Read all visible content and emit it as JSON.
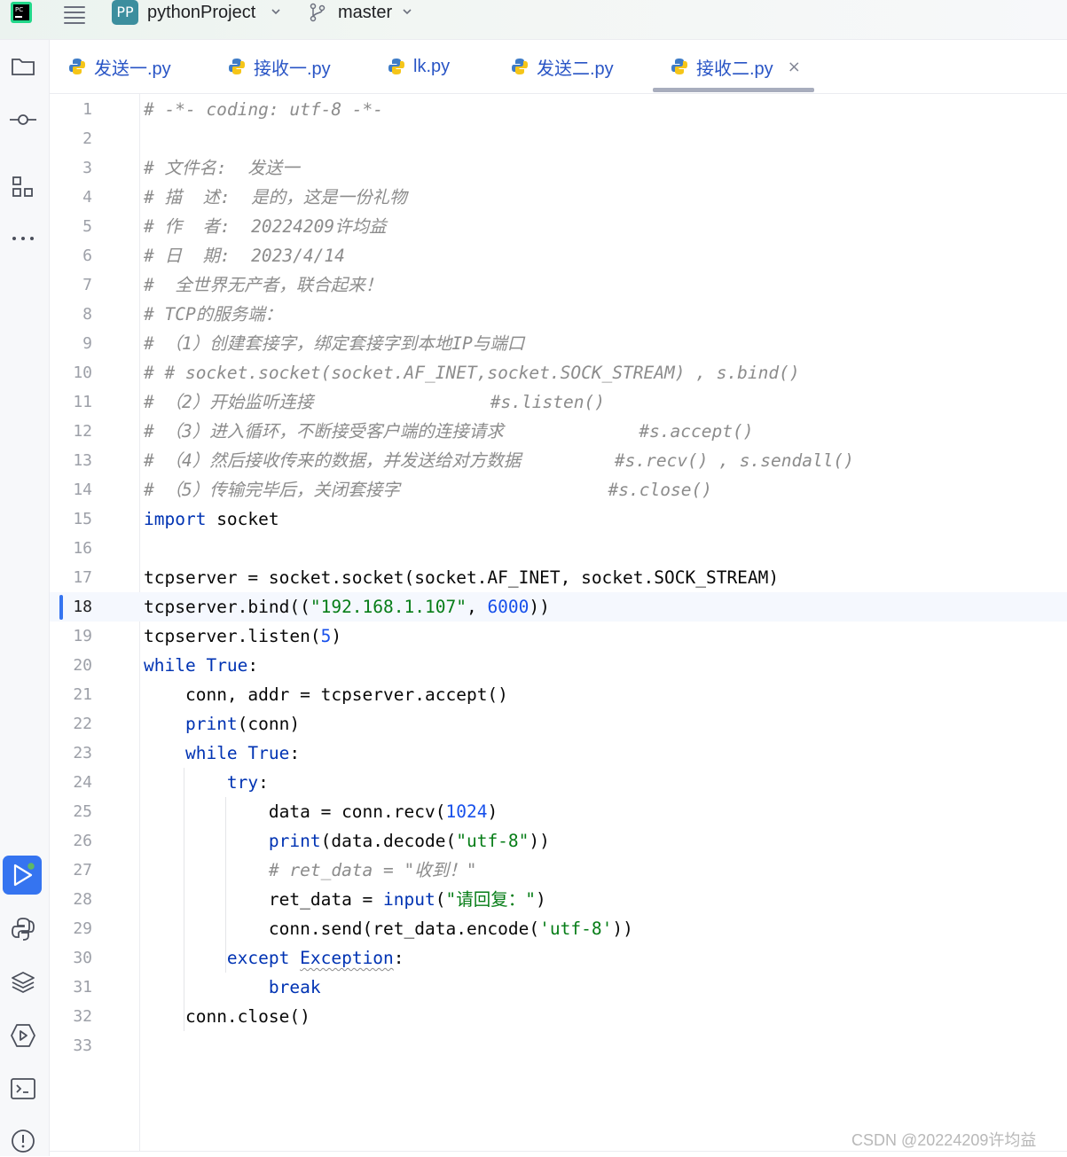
{
  "header": {
    "project_badge": "PP",
    "project_name": "pythonProject",
    "branch_name": "master"
  },
  "tabs": [
    {
      "label": "发送一.py"
    },
    {
      "label": "接收一.py"
    },
    {
      "label": "lk.py"
    },
    {
      "label": "发送二.py"
    },
    {
      "label": "接收二.py",
      "active": true,
      "close": "×"
    }
  ],
  "editor": {
    "current_line": 18,
    "line_numbers": [
      "1",
      "2",
      "3",
      "4",
      "5",
      "6",
      "7",
      "8",
      "9",
      "10",
      "11",
      "12",
      "13",
      "14",
      "15",
      "16",
      "17",
      "18",
      "19",
      "20",
      "21",
      "22",
      "23",
      "24",
      "25",
      "26",
      "27",
      "28",
      "29",
      "30",
      "31",
      "32",
      "33"
    ],
    "lines": [
      {
        "indent": "",
        "tokens": [
          {
            "t": "# -*- coding: utf-8 -*-",
            "c": "cmt"
          }
        ]
      },
      {
        "indent": "",
        "tokens": []
      },
      {
        "indent": "",
        "tokens": [
          {
            "t": "# 文件名:  发送一",
            "c": "cmt"
          }
        ]
      },
      {
        "indent": "",
        "tokens": [
          {
            "t": "# 描  述:  是的，这是一份礼物",
            "c": "cmt"
          }
        ]
      },
      {
        "indent": "",
        "tokens": [
          {
            "t": "# 作  者:  20224209许均益",
            "c": "cmt"
          }
        ]
      },
      {
        "indent": "",
        "tokens": [
          {
            "t": "# 日  期:  2023/4/14",
            "c": "cmt"
          }
        ]
      },
      {
        "indent": "",
        "tokens": [
          {
            "t": "#  全世界无产者，联合起来！",
            "c": "cmt"
          }
        ]
      },
      {
        "indent": "",
        "tokens": [
          {
            "t": "# TCP的服务端：",
            "c": "cmt"
          }
        ]
      },
      {
        "indent": "",
        "tokens": [
          {
            "t": "# （1）创建套接字，绑定套接字到本地IP与端口",
            "c": "cmt"
          }
        ]
      },
      {
        "indent": "",
        "tokens": [
          {
            "t": "# # socket.socket(socket.AF_INET,socket.SOCK_STREAM) , s.bind()",
            "c": "cmt"
          }
        ]
      },
      {
        "indent": "",
        "tokens": [
          {
            "t": "# （2）开始监听连接                 #s.listen()",
            "c": "cmt"
          }
        ]
      },
      {
        "indent": "",
        "tokens": [
          {
            "t": "# （3）进入循环，不断接受客户端的连接请求             #s.accept()",
            "c": "cmt"
          }
        ]
      },
      {
        "indent": "",
        "tokens": [
          {
            "t": "# （4）然后接收传来的数据，并发送给对方数据         #s.recv() , s.sendall()",
            "c": "cmt"
          }
        ]
      },
      {
        "indent": "",
        "tokens": [
          {
            "t": "# （5）传输完毕后，关闭套接字                    #s.close()",
            "c": "cmt"
          }
        ]
      },
      {
        "indent": "",
        "tokens": [
          {
            "t": "import",
            "c": "kw"
          },
          {
            "t": " socket",
            "c": ""
          }
        ]
      },
      {
        "indent": "",
        "tokens": []
      },
      {
        "indent": "",
        "tokens": [
          {
            "t": "tcpserver = socket.socket(socket.AF_INET, socket.SOCK_STREAM)",
            "c": ""
          }
        ]
      },
      {
        "indent": "",
        "tokens": [
          {
            "t": "tcpserver.bind((",
            "c": ""
          },
          {
            "t": "\"192.168.1.107\"",
            "c": "str"
          },
          {
            "t": ", ",
            "c": ""
          },
          {
            "t": "6000",
            "c": "num"
          },
          {
            "t": "))",
            "c": ""
          }
        ]
      },
      {
        "indent": "",
        "tokens": [
          {
            "t": "tcpserver.listen(",
            "c": ""
          },
          {
            "t": "5",
            "c": "num"
          },
          {
            "t": ")",
            "c": ""
          }
        ]
      },
      {
        "indent": "",
        "tokens": [
          {
            "t": "while",
            "c": "kw"
          },
          {
            "t": " ",
            "c": ""
          },
          {
            "t": "True",
            "c": "kw"
          },
          {
            "t": ":",
            "c": ""
          }
        ]
      },
      {
        "indent": "    ",
        "tokens": [
          {
            "t": "conn, addr = tcpserver.accept()",
            "c": ""
          }
        ]
      },
      {
        "indent": "    ",
        "tokens": [
          {
            "t": "print",
            "c": "kw"
          },
          {
            "t": "(conn)",
            "c": ""
          }
        ]
      },
      {
        "indent": "    ",
        "tokens": [
          {
            "t": "while",
            "c": "kw"
          },
          {
            "t": " ",
            "c": ""
          },
          {
            "t": "True",
            "c": "kw"
          },
          {
            "t": ":",
            "c": ""
          }
        ]
      },
      {
        "indent": "        ",
        "tokens": [
          {
            "t": "try",
            "c": "kw"
          },
          {
            "t": ":",
            "c": ""
          }
        ]
      },
      {
        "indent": "            ",
        "tokens": [
          {
            "t": "data = conn.recv(",
            "c": ""
          },
          {
            "t": "1024",
            "c": "num"
          },
          {
            "t": ")",
            "c": ""
          }
        ]
      },
      {
        "indent": "            ",
        "tokens": [
          {
            "t": "print",
            "c": "kw"
          },
          {
            "t": "(data.decode(",
            "c": ""
          },
          {
            "t": "\"utf-8\"",
            "c": "str"
          },
          {
            "t": "))",
            "c": ""
          }
        ]
      },
      {
        "indent": "            ",
        "tokens": [
          {
            "t": "# ret_data = \"收到！\"",
            "c": "cmt"
          }
        ]
      },
      {
        "indent": "            ",
        "tokens": [
          {
            "t": "ret_data = ",
            "c": ""
          },
          {
            "t": "input",
            "c": "kw"
          },
          {
            "t": "(",
            "c": ""
          },
          {
            "t": "\"请回复：\"",
            "c": "str"
          },
          {
            "t": ")",
            "c": ""
          }
        ]
      },
      {
        "indent": "            ",
        "tokens": [
          {
            "t": "conn.send(ret_data.encode(",
            "c": ""
          },
          {
            "t": "'utf-8'",
            "c": "str"
          },
          {
            "t": "))",
            "c": ""
          }
        ]
      },
      {
        "indent": "        ",
        "tokens": [
          {
            "t": "except",
            "c": "kw"
          },
          {
            "t": " ",
            "c": ""
          },
          {
            "t": "Exception",
            "c": "kw wavy"
          },
          {
            "t": ":",
            "c": ""
          }
        ]
      },
      {
        "indent": "            ",
        "tokens": [
          {
            "t": "break",
            "c": "kw"
          }
        ]
      },
      {
        "indent": "    ",
        "tokens": [
          {
            "t": "conn.close()",
            "c": ""
          }
        ]
      },
      {
        "indent": "",
        "tokens": []
      }
    ]
  },
  "watermark": "CSDN @20224209许均益",
  "colors": {
    "keyword": "#0033b3",
    "string": "#067d17",
    "number": "#1750eb",
    "comment": "#8c8c8c",
    "accent": "#3574f0"
  },
  "icons": [
    "project-folder-icon",
    "commit-icon",
    "structure-icon",
    "more-icon",
    "run-icon",
    "python-console-icon",
    "layers-icon",
    "services-icon",
    "terminal-icon",
    "problems-icon"
  ]
}
